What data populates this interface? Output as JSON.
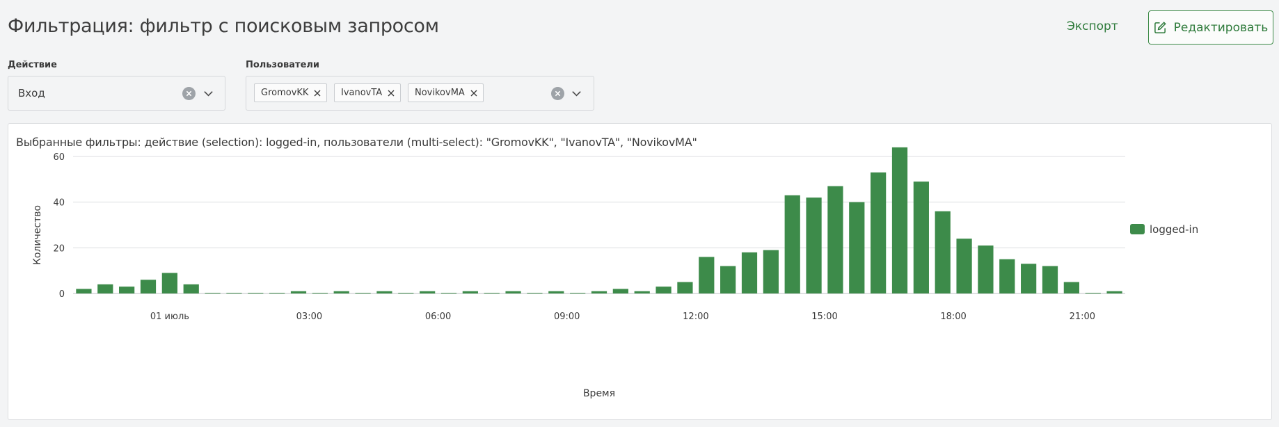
{
  "header": {
    "title": "Фильтрация: фильтр с поисковым запросом",
    "export_label": "Экспорт",
    "edit_label": "Редактировать"
  },
  "filters": {
    "action": {
      "label": "Действие",
      "value": "Вход"
    },
    "users": {
      "label": "Пользователи",
      "tags": [
        "GromovKK",
        "IvanovTA",
        "NovikovMA"
      ]
    }
  },
  "panel": {
    "selected_filters_text": "Выбранные фильтры: действие (selection): logged-in, пользователи (multi-select): \"GromovKK\", \"IvanovTA\", \"NovikovMA\""
  },
  "colors": {
    "accent": "#2d7a3a",
    "bar": "#3d8b4a"
  },
  "chart_data": {
    "type": "bar",
    "xlabel": "Время",
    "ylabel": "Количество",
    "ylim": [
      0,
      65
    ],
    "yticks": [
      0,
      20,
      40,
      60
    ],
    "xtick_labels": [
      {
        "label": "01 июль",
        "index": 4
      },
      {
        "label": "03:00",
        "index": 10.5
      },
      {
        "label": "06:00",
        "index": 16.5
      },
      {
        "label": "09:00",
        "index": 22.5
      },
      {
        "label": "12:00",
        "index": 28.5
      },
      {
        "label": "15:00",
        "index": 34.5
      },
      {
        "label": "18:00",
        "index": 40.5
      },
      {
        "label": "21:00",
        "index": 46.5
      }
    ],
    "grid": true,
    "legend_position": "right",
    "series": [
      {
        "name": "logged-in",
        "values": [
          2,
          4,
          3,
          6,
          9,
          4,
          0,
          0,
          0,
          0,
          1,
          0,
          1,
          0,
          1,
          0,
          1,
          0,
          1,
          0,
          1,
          0,
          1,
          0,
          1,
          2,
          1,
          3,
          5,
          16,
          12,
          18,
          19,
          43,
          42,
          47,
          40,
          53,
          64,
          49,
          36,
          24,
          21,
          15,
          13,
          12,
          5,
          0,
          1
        ]
      }
    ]
  }
}
